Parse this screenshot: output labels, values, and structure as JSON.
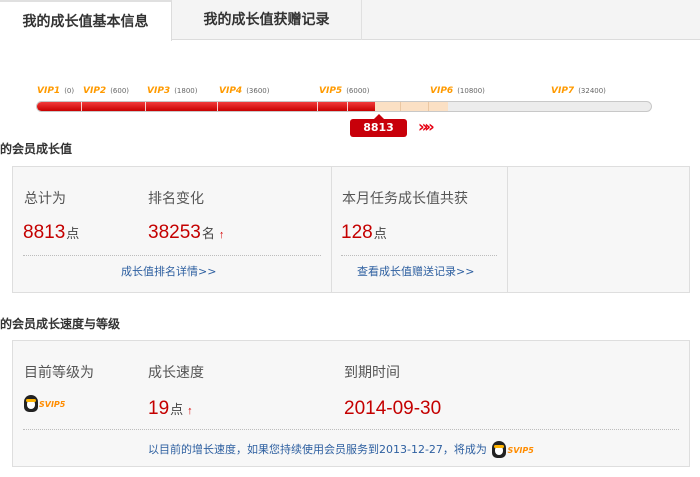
{
  "tabs": [
    {
      "label": "我的成长值基本信息"
    },
    {
      "label": "我的成长值获赠记录"
    }
  ],
  "progress": {
    "current": 8813,
    "max": 32400,
    "levels": [
      {
        "name": "VIP1",
        "threshold": "(0)"
      },
      {
        "name": "VIP2",
        "threshold": "(600)"
      },
      {
        "name": "VIP3",
        "threshold": "(1800)"
      },
      {
        "name": "VIP4",
        "threshold": "(3600)"
      },
      {
        "name": "VIP5",
        "threshold": "(6000)"
      },
      {
        "name": "VIP6",
        "threshold": "(10800)"
      },
      {
        "name": "VIP7",
        "threshold": "(32400)"
      }
    ],
    "current_label": "8813",
    "arrows": "»»"
  },
  "growth": {
    "title": "我的会员成长值",
    "total_label": "总计为",
    "total_value": "8813",
    "total_unit": "点",
    "rank_label": "排名变化",
    "rank_value": "38253",
    "rank_unit": "名",
    "rank_arrow": "↑",
    "monthly_label": "本月任务成长值共获",
    "monthly_value": "128",
    "monthly_unit": "点",
    "rank_link": "成长值排名详情>>",
    "gift_link": "查看成长值赠送记录>>"
  },
  "speed": {
    "title": "我的会员成长速度与等级",
    "level_label": "目前等级为",
    "level_badge": "SVIP5",
    "speed_label": "成长速度",
    "speed_value": "19",
    "speed_unit": "点",
    "speed_arrow": "↑",
    "expire_label": "到期时间",
    "expire_value": "2014-09-30",
    "note": "以目前的增长速度，如果您持续使用会员服务到2013-12-27，将成为",
    "note_badge": "SVIP5"
  },
  "colors": {
    "accent_red": "#c40000",
    "vip_orange": "#ff9a00",
    "link_blue": "#2d5fa0"
  }
}
